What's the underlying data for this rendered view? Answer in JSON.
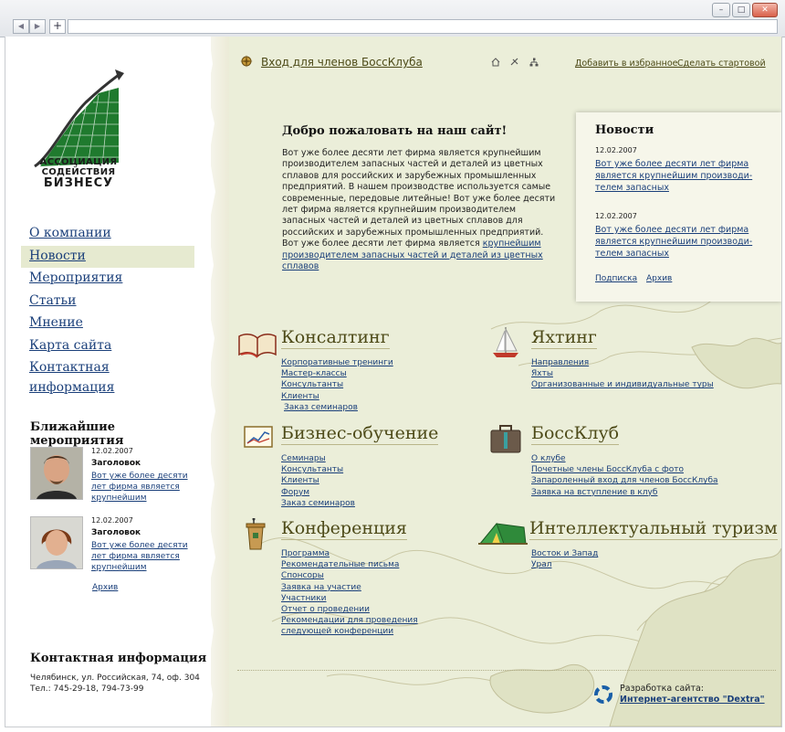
{
  "sidebar": {
    "logo": {
      "line1": "АССОЦИАЦИЯ",
      "line2": "СОДЕЙСТВИЯ",
      "line3": "БИЗНЕСУ"
    },
    "menu": [
      {
        "label": "О компании"
      },
      {
        "label": "Новости"
      },
      {
        "label": "Мероприятия"
      },
      {
        "label": "Статьи"
      },
      {
        "label": "Мнение"
      },
      {
        "label": "Карта сайта"
      },
      {
        "label": "Контактная информация"
      }
    ],
    "active_menu": "Новости",
    "events_title": "Ближайшие мероприятия",
    "events": [
      {
        "date": "12.02.2007",
        "title": "Заголовок",
        "text": "Вот уже более десяти лет фирма является крупнейшим"
      },
      {
        "date": "12.02.2007",
        "title": "Заголовок",
        "text": "Вот уже более десяти лет фирма является крупнейшим"
      }
    ],
    "archive": "Архив",
    "contacts_title": "Контактная информация",
    "address": "Челябинск, ул. Российская, 74, оф. 304",
    "phones": "Тел.: 745-29-18, 794-73-99"
  },
  "header": {
    "member_login": "Вход для членов БоссКлуба",
    "add_favorites": "Добавить в избранное",
    "make_start": "Сделать стартовой",
    "icons": [
      "home-icon",
      "mail-icon",
      "sitemap-icon"
    ]
  },
  "welcome": {
    "title": "Добро пожаловать на наш сайт!",
    "text": "Вот уже более десяти лет фирма является крупнейшим производителем запасных частей и деталей из цветных сплавов для российских и зарубежных промышленных предприятий. В нашем производстве используется самые современные, передовые литейные! Вот уже более десяти лет фирма является крупнейшим производителем запасных частей и деталей из цветных сплавов для российских и зарубежных промышленных предприятий. Вот уже более десяти лет фирма является",
    "link": "крупнейшим производителем запасных частей и деталей из цветных сплавов"
  },
  "news": {
    "title": "Новости",
    "items": [
      {
        "date": "12.02.2007",
        "text": "Вот уже более десяти лет фирма является крупнейшим производи-телем запасных"
      },
      {
        "date": "12.02.2007",
        "text": "Вот уже более десяти лет фирма является крупнейшим производи-телем запасных"
      }
    ],
    "subscribe": "Подписка",
    "archive": "Архив"
  },
  "sections": [
    {
      "title": "Консалтинг",
      "icon": "book-icon",
      "links": [
        "Корпоративные тренинги",
        "Мастер-классы",
        "Консультанты",
        "Клиенты",
        "Заказ семинаров"
      ]
    },
    {
      "title": "Яхтинг",
      "icon": "sailboat-icon",
      "links": [
        "Направления",
        "Яхты",
        "Организованные и индивидуальные туры"
      ]
    },
    {
      "title": "Бизнес-обучение",
      "icon": "chart-icon",
      "links": [
        "Семинары",
        "Консультанты",
        "Клиенты",
        "Форум",
        "Заказ семинаров"
      ]
    },
    {
      "title": "БоссКлуб",
      "icon": "briefcase-icon",
      "links": [
        "О клубе",
        "Почетные члены БоссКлуба с фото",
        "Запароленный вход для членов БоссКлуба",
        "Заявка на вступление в клуб"
      ]
    },
    {
      "title": "Конференция",
      "icon": "podium-icon",
      "links": [
        "Программа",
        "Рекомендательные письма",
        "Спонсоры",
        "Заявка на участие",
        "Участники",
        "Отчет о проведении",
        "Рекомендации для проведения",
        "следующей конференции"
      ]
    },
    {
      "title": "Интеллектуальный туризм",
      "icon": "tent-icon",
      "links": [
        "Восток и Запад",
        "Урал"
      ]
    }
  ],
  "footer": {
    "dev_label": "Разработка сайта:",
    "dev_link": "Интернет-агентство \"Dextra\""
  },
  "colors": {
    "link": "#1a3f7a",
    "olive": "#4d4a18",
    "background": "#ebeed9",
    "logo_green": "#1f7a2e"
  }
}
